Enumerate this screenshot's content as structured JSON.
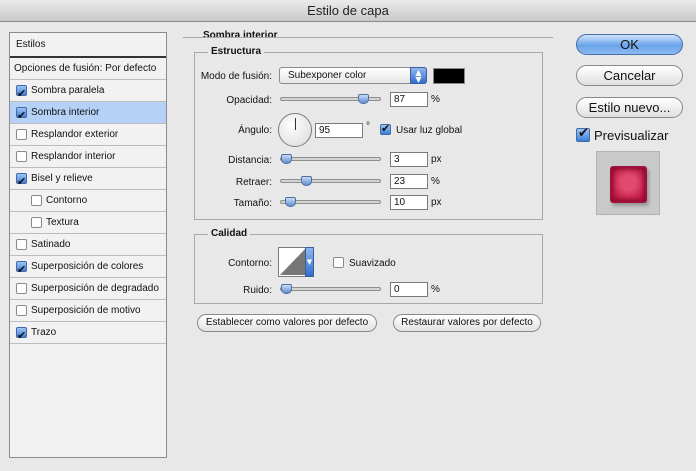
{
  "window": {
    "title": "Estilo de capa"
  },
  "styles": {
    "header": "Estilos",
    "blend_options": "Opciones de fusión: Por defecto",
    "items": [
      {
        "label": "Sombra paralela",
        "checked": true,
        "selected": false,
        "sub": false
      },
      {
        "label": "Sombra interior",
        "checked": true,
        "selected": true,
        "sub": false
      },
      {
        "label": "Resplandor exterior",
        "checked": false,
        "selected": false,
        "sub": false
      },
      {
        "label": "Resplandor interior",
        "checked": false,
        "selected": false,
        "sub": false
      },
      {
        "label": "Bisel y relieve",
        "checked": true,
        "selected": false,
        "sub": false
      },
      {
        "label": "Contorno",
        "checked": false,
        "selected": false,
        "sub": true
      },
      {
        "label": "Textura",
        "checked": false,
        "selected": false,
        "sub": true
      },
      {
        "label": "Satinado",
        "checked": false,
        "selected": false,
        "sub": false
      },
      {
        "label": "Superposición de colores",
        "checked": true,
        "selected": false,
        "sub": false
      },
      {
        "label": "Superposición de degradado",
        "checked": false,
        "selected": false,
        "sub": false
      },
      {
        "label": "Superposición de motivo",
        "checked": false,
        "selected": false,
        "sub": false
      },
      {
        "label": "Trazo",
        "checked": true,
        "selected": false,
        "sub": false
      }
    ]
  },
  "panel": {
    "title": "Sombra interior",
    "structure": {
      "title": "Estructura",
      "blend_mode_label": "Modo de fusión:",
      "blend_mode_value": "Subexponer color",
      "color_swatch": "#000000",
      "opacity_label": "Opacidad:",
      "opacity_value": "87",
      "opacity_fraction": 0.87,
      "opacity_unit": "%",
      "angle_label": "Ángulo:",
      "angle_value": "95",
      "angle_unit": "°",
      "global_light_label": "Usar luz global",
      "global_light_checked": true,
      "distance_label": "Distancia:",
      "distance_value": "3",
      "distance_fraction": 0.0,
      "distance_unit": "px",
      "choke_label": "Retraer:",
      "choke_value": "23",
      "choke_fraction": 0.23,
      "choke_unit": "%",
      "size_label": "Tamaño:",
      "size_value": "10",
      "size_fraction": 0.04,
      "size_unit": "px"
    },
    "quality": {
      "title": "Calidad",
      "contour_label": "Contorno:",
      "antialias_label": "Suavizado",
      "antialias_checked": false,
      "noise_label": "Ruido:",
      "noise_value": "0",
      "noise_fraction": 0.0,
      "noise_unit": "%"
    },
    "make_default_label": "Establecer como valores por defecto",
    "reset_default_label": "Restaurar valores por defecto"
  },
  "buttons": {
    "ok": "OK",
    "cancel": "Cancelar",
    "new_style": "Estilo nuevo...",
    "preview_label": "Previsualizar",
    "preview_checked": true
  }
}
